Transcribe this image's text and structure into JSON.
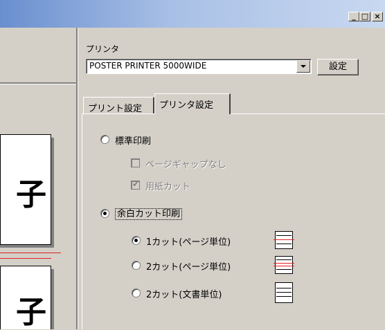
{
  "window": {
    "minimize_glyph": "_",
    "maximize_glyph": "□",
    "close_glyph": "×"
  },
  "preview": {
    "page_glyph_top": "子",
    "page_glyph_bottom": "子"
  },
  "printer": {
    "label": "プリンタ",
    "selected": "POSTER PRINTER 5000WIDE",
    "settings_button": "設定"
  },
  "tabs": [
    {
      "label": "プリント設定",
      "active": false
    },
    {
      "label": "プリンタ設定",
      "active": true
    }
  ],
  "print_mode": {
    "standard": {
      "label": "標準印刷",
      "selected": false
    },
    "no_page_gap": {
      "label": "ページギャップなし",
      "checked": false,
      "enabled": false
    },
    "paper_cut": {
      "label": "用紙カット",
      "checked": true,
      "enabled": false
    },
    "margin_cut": {
      "label": "余白カット印刷",
      "selected": true
    },
    "cut_options": [
      {
        "label": "1カット(ページ単位)",
        "selected": true,
        "icon": "cut-1-page-icon"
      },
      {
        "label": "2カット(ページ単位)",
        "selected": false,
        "icon": "cut-2-page-icon"
      },
      {
        "label": "2カット(文書単位)",
        "selected": false,
        "icon": "cut-2-document-icon"
      }
    ]
  },
  "colors": {
    "titlebar_start": "#6a8fcf",
    "titlebar_end": "#c8d8f0",
    "cut_line": "#e02020",
    "face": "#d4d0c8"
  }
}
